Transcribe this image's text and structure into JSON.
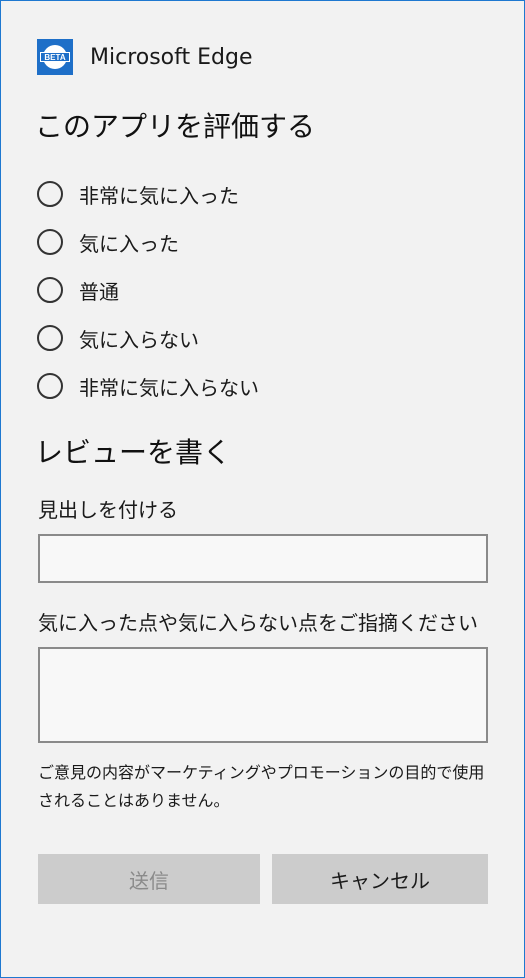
{
  "app": {
    "name": "Microsoft Edge",
    "logo_badge": "BETA",
    "accent_color": "#1e78d0"
  },
  "rating": {
    "title": "このアプリを評価する",
    "options": [
      "非常に気に入った",
      "気に入った",
      "普通",
      "気に入らない",
      "非常に気に入らない"
    ],
    "selected": null
  },
  "review": {
    "title": "レビューを書く",
    "headline_label": "見出しを付ける",
    "headline_value": "",
    "comment_label": "気に入った点や気に入らない点をご指摘ください",
    "comment_value": "",
    "disclaimer": "ご意見の内容がマーケティングやプロモーションの目的で使用されることはありません。"
  },
  "buttons": {
    "send": "送信",
    "send_enabled": false,
    "cancel": "キャンセル"
  }
}
